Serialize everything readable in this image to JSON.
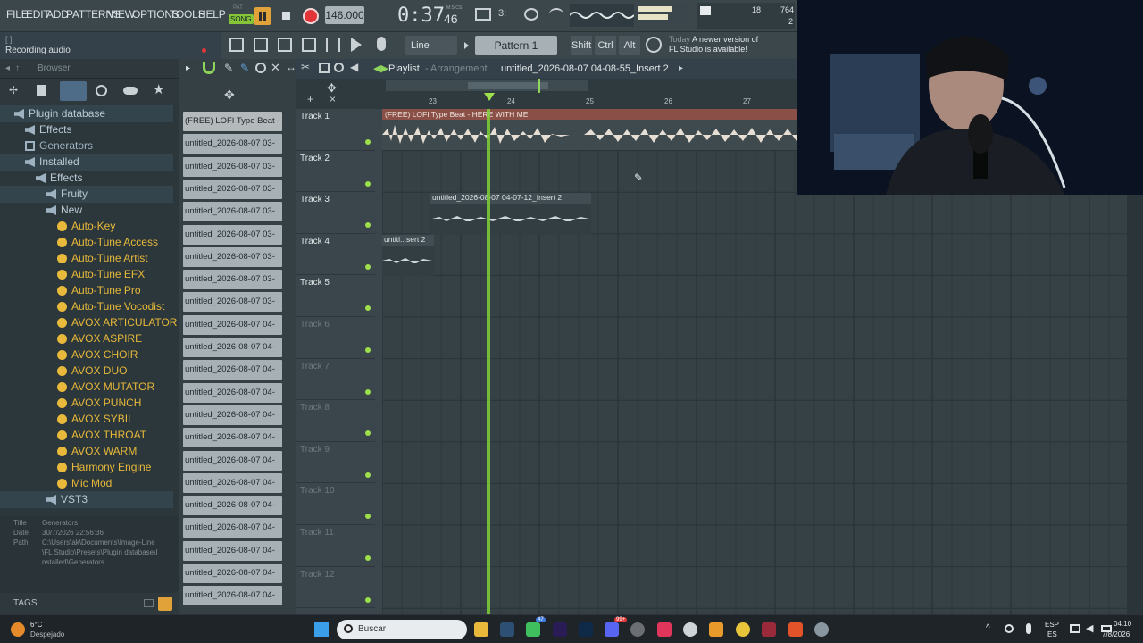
{
  "menu": [
    "FILE",
    "EDIT",
    "ADD",
    "PATTERNS",
    "VIEW",
    "OPTIONS",
    "TOOLS",
    "HELP"
  ],
  "transport": {
    "mode": "SONG",
    "pat_label": "PAT",
    "tempo": "146.000",
    "time": "0:37",
    "time_sub": "46",
    "time_unit": "M:S:CS",
    "cpu": "18",
    "ram": "764",
    "voices": "2"
  },
  "hint": {
    "bracket": "[ ]",
    "text": "Recording audio"
  },
  "toolbar2": {
    "snap": "Line",
    "pattern": "Pattern 1",
    "shift": "Shift",
    "ctrl": "Ctrl",
    "alt": "Alt",
    "news_prefix": "Today",
    "news_text": "A newer version of",
    "news_text2": "FL Studio is available!"
  },
  "browser": {
    "title": "Browser",
    "tree": [
      {
        "label": "Plugin database",
        "indent": 0,
        "type": "db",
        "sel": true
      },
      {
        "label": "Effects",
        "indent": 1,
        "type": "folder"
      },
      {
        "label": "Generators",
        "indent": 1,
        "type": "gen"
      },
      {
        "label": "Installed",
        "indent": 1,
        "type": "folder",
        "sel": true
      },
      {
        "label": "Effects",
        "indent": 2,
        "type": "folder"
      },
      {
        "label": "Fruity",
        "indent": 3,
        "type": "folder",
        "sel": true
      },
      {
        "label": "New",
        "indent": 3,
        "type": "folder"
      },
      {
        "label": "Auto-Key",
        "indent": 4,
        "type": "plugin"
      },
      {
        "label": "Auto-Tune Access",
        "indent": 4,
        "type": "plugin"
      },
      {
        "label": "Auto-Tune Artist",
        "indent": 4,
        "type": "plugin"
      },
      {
        "label": "Auto-Tune EFX",
        "indent": 4,
        "type": "plugin"
      },
      {
        "label": "Auto-Tune Pro",
        "indent": 4,
        "type": "plugin"
      },
      {
        "label": "Auto-Tune Vocodist",
        "indent": 4,
        "type": "plugin"
      },
      {
        "label": "AVOX ARTICULATOR",
        "indent": 4,
        "type": "plugin"
      },
      {
        "label": "AVOX ASPIRE",
        "indent": 4,
        "type": "plugin"
      },
      {
        "label": "AVOX CHOIR",
        "indent": 4,
        "type": "plugin"
      },
      {
        "label": "AVOX DUO",
        "indent": 4,
        "type": "plugin"
      },
      {
        "label": "AVOX MUTATOR",
        "indent": 4,
        "type": "plugin"
      },
      {
        "label": "AVOX PUNCH",
        "indent": 4,
        "type": "plugin"
      },
      {
        "label": "AVOX SYBIL",
        "indent": 4,
        "type": "plugin"
      },
      {
        "label": "AVOX THROAT",
        "indent": 4,
        "type": "plugin"
      },
      {
        "label": "AVOX WARM",
        "indent": 4,
        "type": "plugin"
      },
      {
        "label": "Harmony Engine",
        "indent": 4,
        "type": "plugin"
      },
      {
        "label": "Mic Mod",
        "indent": 4,
        "type": "plugin"
      },
      {
        "label": "VST3",
        "indent": 3,
        "type": "folder",
        "sel": true
      }
    ],
    "info": {
      "title_k": "Title",
      "title_v": "Generators",
      "date_k": "Date",
      "date_v": "30/7/2026 22:56:36",
      "path_k": "Path",
      "path_v1": "C:\\Users\\ak\\Documents\\Image-Line",
      "path_v2": "\\FL Studio\\Presets\\Plugin database\\I",
      "path_v3": "nstalled\\Generators"
    },
    "tags": "TAGS"
  },
  "clips": [
    "(FREE) LOFI Type Beat -",
    "untitled_2026-08-07 03-",
    "untitled_2026-08-07 03-",
    "untitled_2026-08-07 03-",
    "untitled_2026-08-07 03-",
    "untitled_2026-08-07 03-",
    "untitled_2026-08-07 03-",
    "untitled_2026-08-07 03-",
    "untitled_2026-08-07 03-",
    "untitled_2026-08-07 04-",
    "untitled_2026-08-07 04-",
    "untitled_2026-08-07 04-",
    "untitled_2026-08-07 04-",
    "untitled_2026-08-07 04-",
    "untitled_2026-08-07 04-",
    "untitled_2026-08-07 04-",
    "untitled_2026-08-07 04-",
    "untitled_2026-08-07 04-",
    "untitled_2026-08-07 04-",
    "untitled_2026-08-07 04-",
    "untitled_2026-08-07 04-",
    "untitled_2026-08-07 04-"
  ],
  "playlist": {
    "title": "Playlist",
    "arrangement": "Arrangement",
    "project": "untitled_2026-08-07 04-08-55_Insert 2",
    "bars": [
      "23",
      "24",
      "25",
      "26",
      "27"
    ],
    "tracks": [
      "Track 1",
      "Track 2",
      "Track 3",
      "Track 4",
      "Track 5",
      "Track 6",
      "Track 7",
      "Track 8",
      "Track 9",
      "Track 10",
      "Track 11",
      "Track 12"
    ],
    "clip1": "(FREE) LOFI Type Beat - HERE WITH ME",
    "clip3": "untitled_2026-08-07 04-07-12_Insert 2",
    "clip4": "untitl...sert 2"
  },
  "taskbar": {
    "temp": "6°C",
    "weather": "Despejado",
    "search": "Buscar",
    "lang1": "ESP",
    "lang2": "ES",
    "time": "04:10",
    "date": "7/8/2026",
    "badge1": "47",
    "badge2": "99+"
  }
}
